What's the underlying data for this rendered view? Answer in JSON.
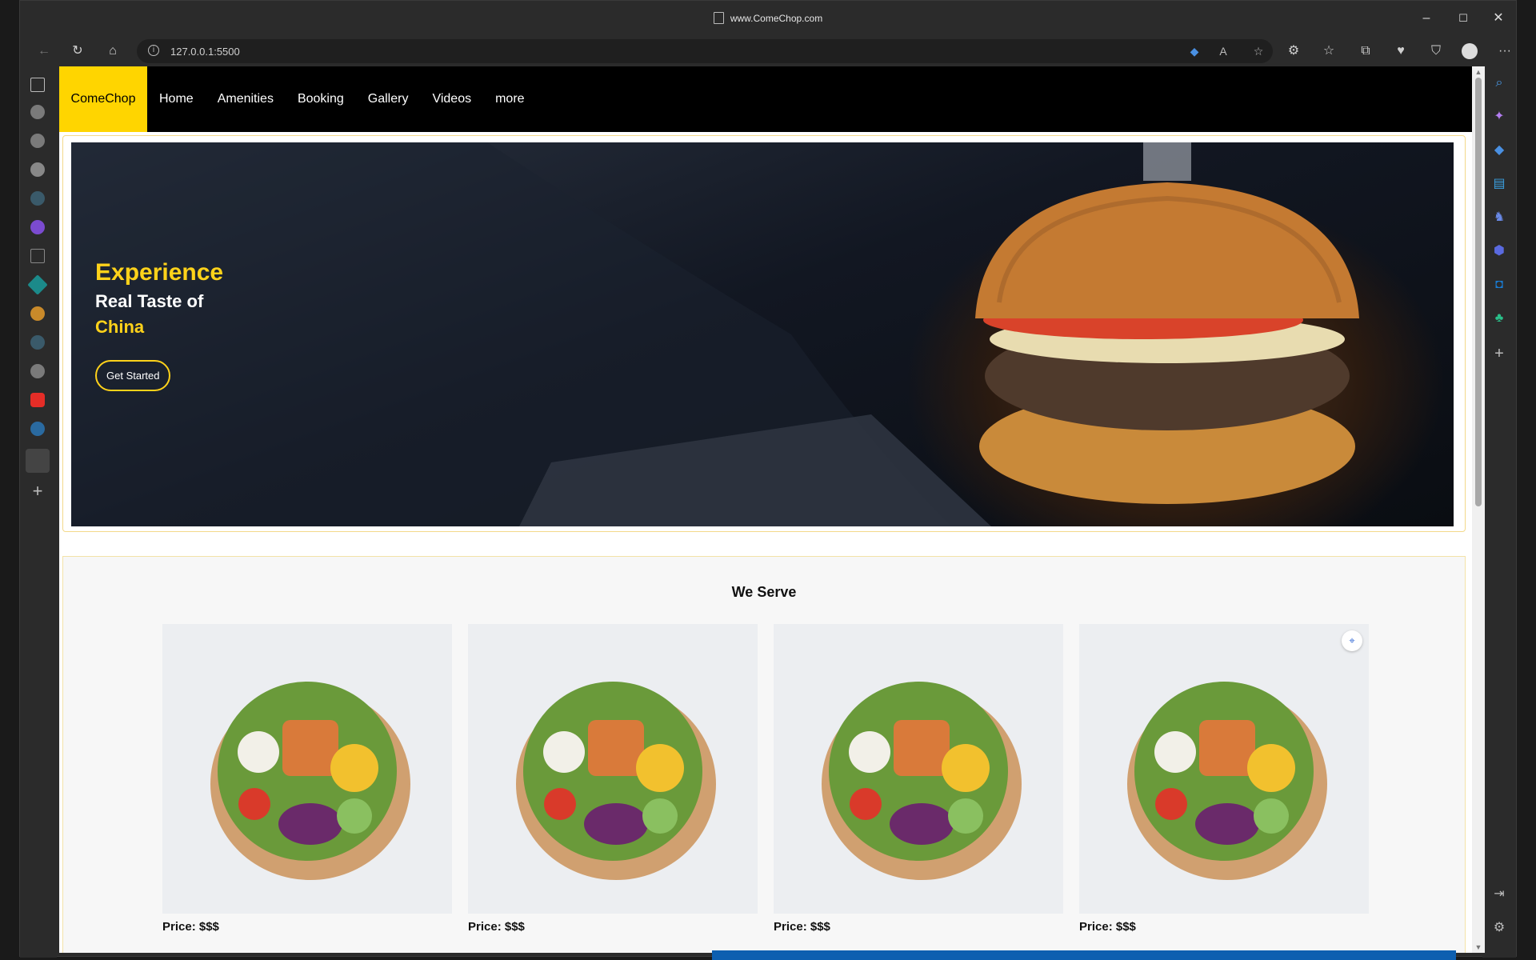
{
  "window": {
    "title": "www.ComeChop.com",
    "minimize": "–",
    "maximize": "☐",
    "close": "✕"
  },
  "toolbar": {
    "back": "←",
    "reload": "↻",
    "home": "⌂",
    "address": "127.0.0.1:5500",
    "more": "···"
  },
  "site": {
    "brand": "ComeChop",
    "nav": [
      "Home",
      "Amenities",
      "Booking",
      "Gallery",
      "Videos",
      "more"
    ],
    "hero": {
      "line1": "Experience",
      "line2": "Real Taste of",
      "line3": "China",
      "cta": "Get Started"
    },
    "serve": {
      "title": "We Serve",
      "items": [
        {
          "price": "Price: $$$"
        },
        {
          "price": "Price: $$$"
        },
        {
          "price": "Price: $$$"
        },
        {
          "price": "Price: $$$"
        }
      ]
    }
  },
  "colors": {
    "brand_yellow": "#ffd500",
    "nav_bg": "#000000",
    "browser_chrome": "#2b2b2b"
  },
  "icons": {
    "page": "page-icon",
    "info": "info-icon",
    "search": "search-icon",
    "copilot": "copilot-icon",
    "add": "plus-icon",
    "settings": "gear-icon"
  }
}
